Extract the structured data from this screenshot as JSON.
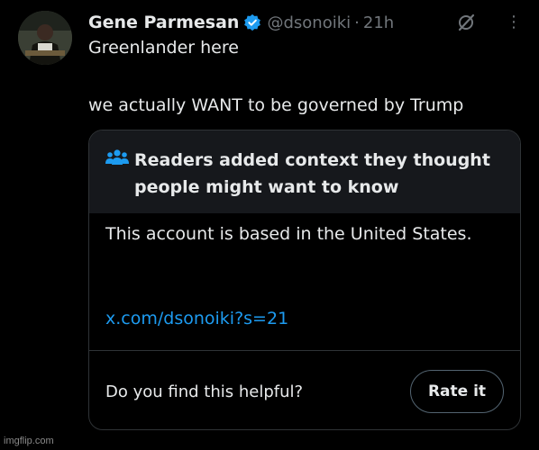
{
  "post": {
    "author": {
      "display_name": "Gene Parmesan",
      "handle": "@dsonoiki",
      "separator": "·",
      "time": "21h",
      "verified": true
    },
    "text_line1": "Greenlander here",
    "text_line2": "we actually WANT to be governed by Trump",
    "icons": [
      "avatar",
      "verified-badge-icon",
      "grok-icon",
      "more-icon"
    ]
  },
  "community_note": {
    "header_icon": "people-icon",
    "title": "Readers added context they thought people might want to know",
    "body": "This account is based in the United States.",
    "link": "x.com/dsonoiki?s=21",
    "helpful_question": "Do you find this helpful?",
    "rate_button_label": "Rate it"
  },
  "watermark": "imgflip.com",
  "colors": {
    "background": "#000000",
    "text": "#e7e9ea",
    "muted": "#71767b",
    "link": "#1d9bf0",
    "verified": "#1d9bf0",
    "note_header_bg": "#16181c",
    "border": "#2f3336"
  }
}
